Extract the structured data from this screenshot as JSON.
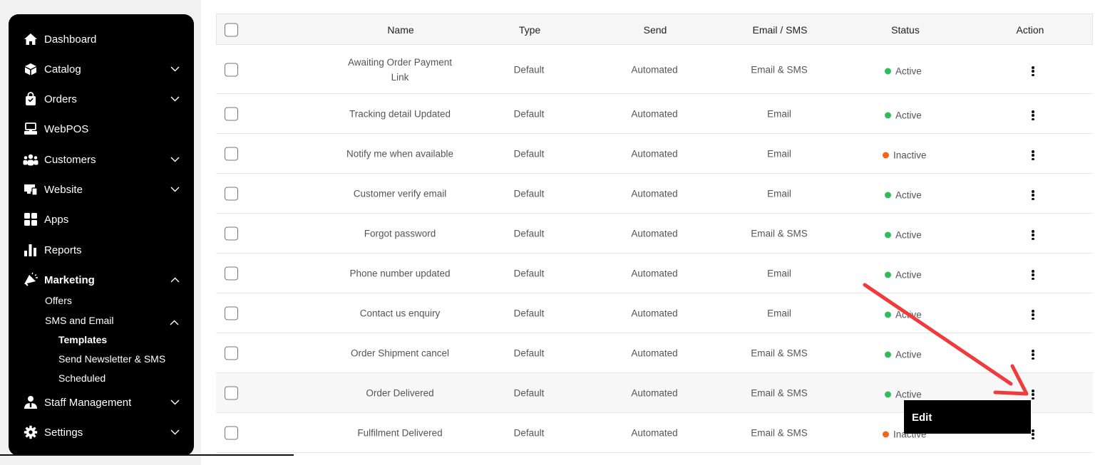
{
  "sidebar": {
    "items": [
      {
        "label": "Dashboard",
        "icon": "home-icon",
        "chevron": ""
      },
      {
        "label": "Catalog",
        "icon": "box-icon",
        "chevron": "down"
      },
      {
        "label": "Orders",
        "icon": "shopping-bag-icon",
        "chevron": "down"
      },
      {
        "label": "WebPOS",
        "icon": "pos-terminal-icon",
        "chevron": ""
      },
      {
        "label": "Customers",
        "icon": "users-icon",
        "chevron": "down"
      },
      {
        "label": "Website",
        "icon": "website-icon",
        "chevron": "down"
      },
      {
        "label": "Apps",
        "icon": "apps-grid-icon",
        "chevron": ""
      },
      {
        "label": "Reports",
        "icon": "bar-chart-icon",
        "chevron": ""
      },
      {
        "label": "Marketing",
        "icon": "megaphone-icon",
        "chevron": "up"
      },
      {
        "label": "Staff Management",
        "icon": "staff-icon",
        "chevron": "down"
      },
      {
        "label": "Settings",
        "icon": "gear-icon",
        "chevron": "down"
      }
    ],
    "marketing_sub": {
      "offers": "Offers",
      "sms_email": "SMS and Email",
      "templates": "Templates",
      "newsletter": "Send Newsletter & SMS",
      "scheduled": "Scheduled"
    }
  },
  "table": {
    "headers": {
      "name": "Name",
      "type": "Type",
      "send": "Send",
      "channel": "Email / SMS",
      "status": "Status",
      "action": "Action"
    },
    "rows": [
      {
        "name": "Awaiting Order Payment Link",
        "type": "Default",
        "send": "Automated",
        "channel": "Email & SMS",
        "status": "Active"
      },
      {
        "name": "Tracking detail Updated",
        "type": "Default",
        "send": "Automated",
        "channel": "Email",
        "status": "Active"
      },
      {
        "name": "Notify me when available",
        "type": "Default",
        "send": "Automated",
        "channel": "Email",
        "status": "Inactive"
      },
      {
        "name": "Customer verify email",
        "type": "Default",
        "send": "Automated",
        "channel": "Email",
        "status": "Active"
      },
      {
        "name": "Forgot password",
        "type": "Default",
        "send": "Automated",
        "channel": "Email & SMS",
        "status": "Active"
      },
      {
        "name": "Phone number updated",
        "type": "Default",
        "send": "Automated",
        "channel": "Email",
        "status": "Active"
      },
      {
        "name": "Contact us enquiry",
        "type": "Default",
        "send": "Automated",
        "channel": "Email",
        "status": "Active"
      },
      {
        "name": "Order Shipment cancel",
        "type": "Default",
        "send": "Automated",
        "channel": "Email & SMS",
        "status": "Active"
      },
      {
        "name": "Order Delivered",
        "type": "Default",
        "send": "Automated",
        "channel": "Email & SMS",
        "status": "Active"
      },
      {
        "name": "Fulfilment Delivered",
        "type": "Default",
        "send": "Automated",
        "channel": "Email & SMS",
        "status": "Inactive"
      }
    ]
  },
  "action_menu": {
    "edit_label": "Edit"
  },
  "colors": {
    "sidebar_bg": "#000000",
    "active_dot": "#2ebd59",
    "inactive_dot": "#f26419",
    "annotation_arrow": "#ef3b3b"
  }
}
